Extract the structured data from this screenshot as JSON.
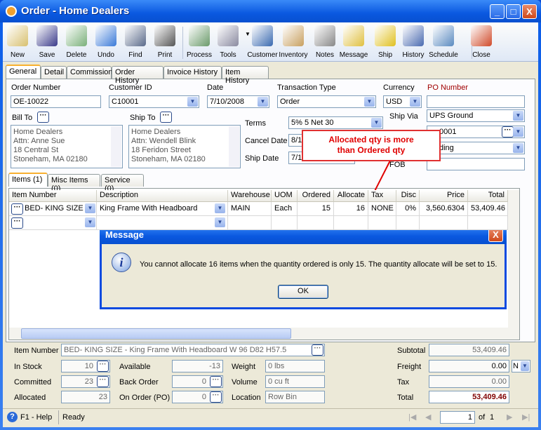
{
  "window": {
    "title": "Order - Home Dealers",
    "minimize": "_",
    "maximize": "□",
    "close": "X"
  },
  "toolbar": [
    {
      "label": "New",
      "icon": "new-icon",
      "color": "#d8c070"
    },
    {
      "label": "Save",
      "icon": "save-icon",
      "color": "#3a3a8a"
    },
    {
      "label": "Delete",
      "icon": "delete-icon",
      "color": "#7ab07a"
    },
    {
      "label": "Undo",
      "icon": "undo-icon",
      "color": "#3a7ad8"
    },
    {
      "label": "Find",
      "icon": "find-icon",
      "color": "#5a6a8a"
    },
    {
      "label": "Print",
      "icon": "print-icon",
      "color": "#555555"
    },
    {
      "label": "Process",
      "icon": "process-icon",
      "color": "#6a9a6a"
    },
    {
      "label": "Tools",
      "icon": "tools-icon",
      "color": "#8a8aa0"
    },
    {
      "label": "Customer",
      "icon": "customer-icon",
      "color": "#3a6ab0"
    },
    {
      "label": "Inventory",
      "icon": "inventory-icon",
      "color": "#c8a060"
    },
    {
      "label": "Notes",
      "icon": "notes-icon",
      "color": "#888888"
    },
    {
      "label": "Message",
      "icon": "message-icon",
      "color": "#e0c040"
    },
    {
      "label": "Ship",
      "icon": "ship-icon",
      "color": "#e0c020"
    },
    {
      "label": "History",
      "icon": "history-icon",
      "color": "#4a6ab0"
    },
    {
      "label": "Schedule",
      "icon": "schedule-icon",
      "color": "#5a8ac0"
    },
    {
      "label": "Close",
      "icon": "close-icon",
      "color": "#d04a2a"
    }
  ],
  "tabs": [
    "General",
    "Detail",
    "Commission",
    "Order History",
    "Invoice History",
    "Item History"
  ],
  "form": {
    "order_number": {
      "label": "Order Number",
      "value": "OE-10022"
    },
    "customer_id": {
      "label": "Customer ID",
      "value": "C10001"
    },
    "date": {
      "label": "Date",
      "value": "7/10/2008"
    },
    "transaction_type": {
      "label": "Transaction Type",
      "value": "Order"
    },
    "currency": {
      "label": "Currency",
      "value": "USD"
    },
    "po_number": {
      "label": "PO Number",
      "value": "",
      "color": "#a00000"
    },
    "bill_to": {
      "label": "Bill To",
      "lines": [
        "Home Dealers",
        "Attn: Anne Sue",
        "18 Central St",
        "Stoneham, MA 02180"
      ]
    },
    "ship_to": {
      "label": "Ship To",
      "lines": [
        "Home Dealers",
        "Attn: Wendell Blink",
        "18 Feridon Street",
        "Stoneham, MA 02180"
      ]
    },
    "terms": {
      "label": "Terms",
      "value": "5% 5 Net 30"
    },
    "cancel_date": {
      "label": "Cancel Date",
      "value": "8/1"
    },
    "ship_date": {
      "label": "Ship Date",
      "value": "7/1"
    },
    "ship_via": {
      "label": "Ship Via",
      "value": "UPS Ground"
    },
    "field2": {
      "value": "0001"
    },
    "field3": {
      "value": "ding"
    },
    "fob": {
      "label": "FOB",
      "value": ""
    }
  },
  "callout": {
    "text": "Allocated qty is more than Ordered qty",
    "color": "#e00000"
  },
  "item_tabs": [
    "Items (1)",
    "Misc Items (0)",
    "Service (0)"
  ],
  "grid": {
    "columns": [
      "Item Number",
      "Description",
      "Warehouse",
      "UOM",
      "Ordered",
      "Allocate",
      "Tax",
      "Disc",
      "Price",
      "Total"
    ],
    "rows": [
      [
        "BED- KING SIZE",
        "King Frame With  Headboard",
        "MAIN",
        "Each",
        "15",
        "16",
        "NONE",
        "0%",
        "3,560.6304",
        "53,409.46"
      ],
      [
        "",
        "",
        "",
        "",
        "",
        "",
        "",
        "",
        "",
        ""
      ]
    ]
  },
  "dialog": {
    "title": "Message",
    "message": "You cannot allocate 16 items when the quantity ordered is only 15. The quantity allocate will  be set to 15.",
    "ok": "OK"
  },
  "details": {
    "item_number": {
      "label": "Item Number",
      "value": "BED- KING SIZE - King Frame With  Headboard W 96 D82  H57.5"
    },
    "in_stock": {
      "label": "In Stock",
      "value": "10"
    },
    "committed": {
      "label": "Committed",
      "value": "23"
    },
    "allocated": {
      "label": "Allocated",
      "value": "23"
    },
    "available": {
      "label": "Available",
      "value": "-13"
    },
    "back_order": {
      "label": "Back Order",
      "value": "0"
    },
    "on_order": {
      "label": "On Order (PO)",
      "value": "0"
    },
    "weight": {
      "label": "Weight",
      "value": "0 lbs"
    },
    "volume": {
      "label": "Volume",
      "value": "0 cu ft"
    },
    "location": {
      "label": "Location",
      "value": "Row  Bin"
    }
  },
  "totals": {
    "subtotal": {
      "label": "Subtotal",
      "value": "53,409.46"
    },
    "freight": {
      "label": "Freight",
      "value": "0.00",
      "option": "N"
    },
    "tax": {
      "label": "Tax",
      "value": "0.00"
    },
    "total": {
      "label": "Total",
      "value": "53,409.46",
      "color": "#800000"
    }
  },
  "status": {
    "help": "F1 - Help",
    "text": "Ready",
    "page": "1",
    "of": "of",
    "total_pages": "1"
  }
}
